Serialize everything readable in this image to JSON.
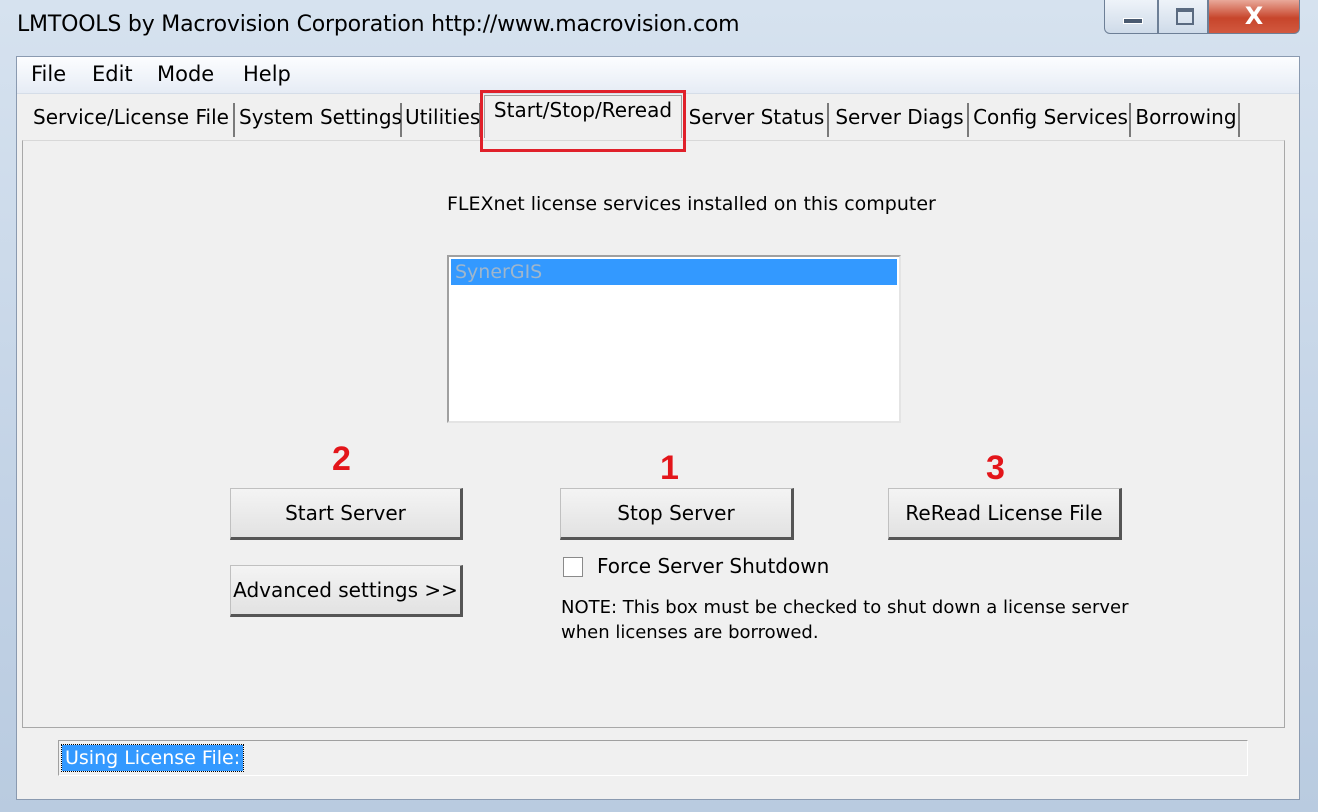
{
  "window": {
    "title": "LMTOOLS by Macrovision Corporation http://www.macrovision.com",
    "close_glyph": "X"
  },
  "menu": [
    "File",
    "Edit",
    "Mode",
    "Help"
  ],
  "tabs": [
    {
      "label": "Service/License File"
    },
    {
      "label": "System Settings"
    },
    {
      "label": "Utilities"
    },
    {
      "label": "Start/Stop/Reread",
      "active": true
    },
    {
      "label": "Server Status"
    },
    {
      "label": "Server Diags"
    },
    {
      "label": "Config Services"
    },
    {
      "label": "Borrowing"
    }
  ],
  "panel": {
    "heading": "FLEXnet license services installed on this computer",
    "services": [
      "SynerGIS"
    ],
    "buttons": {
      "start": "Start Server",
      "stop": "Stop Server",
      "reread": "ReRead License File",
      "advanced": "Advanced settings >>"
    },
    "annotations": {
      "start": "2",
      "stop": "1",
      "reread": "3"
    },
    "force_shutdown_label": "Force Server Shutdown",
    "force_shutdown_checked": false,
    "note_line1": "NOTE:  This box must be checked to shut down a license server",
    "note_line2": "when licenses are borrowed."
  },
  "status": {
    "text": "Using License File:"
  },
  "colors": {
    "annotation": "#e3151a",
    "selection": "#3399ff",
    "highlight_box": "#e0202a"
  }
}
